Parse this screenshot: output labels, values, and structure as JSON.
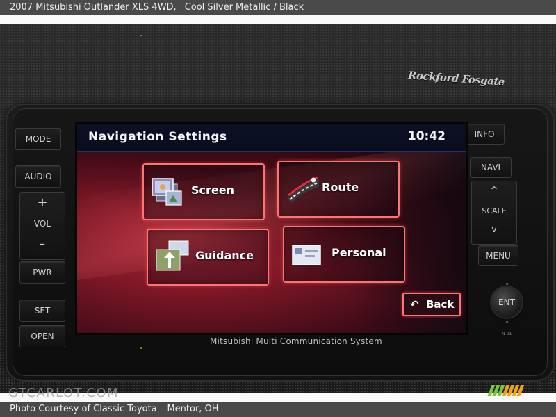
{
  "caption": {
    "vehicle": "2007 Mitsubishi Outlander XLS 4WD,",
    "color": "Cool Silver Metallic / Black",
    "credit": "Photo Courtesy of Classic Toyota – Mentor, OH"
  },
  "brand_text": "Rockford Fosgate",
  "hardware": {
    "mode": "MODE",
    "audio": "AUDIO",
    "vol_plus": "+",
    "vol": "VOL",
    "vol_minus": "–",
    "pwr": "PWR",
    "set": "SET",
    "open": "OPEN",
    "info": "INFO",
    "navi": "NAVI",
    "scale_up": "^",
    "scale": "SCALE",
    "scale_down": "v",
    "menu": "MENU",
    "ent": "ENT",
    "model_code": "N-01"
  },
  "screen": {
    "title": "Navigation Settings",
    "clock": "10:42",
    "tiles": [
      {
        "label": "Screen",
        "icon": "screen-settings-icon"
      },
      {
        "label": "Route",
        "icon": "route-road-icon"
      },
      {
        "label": "Guidance",
        "icon": "guidance-arrow-icon"
      },
      {
        "label": "Personal",
        "icon": "personal-card-icon"
      }
    ],
    "back_label": "Back",
    "back_icon": "back-arrow-icon"
  },
  "system_label": "Mitsubishi Multi Communication System",
  "watermark": "GTCARLOT.COM",
  "colors": {
    "tile_border": "#ff7373",
    "title_bar": "#0c1025",
    "screen_red": "#b02a38",
    "caption_bg": "#4a4a4a"
  }
}
